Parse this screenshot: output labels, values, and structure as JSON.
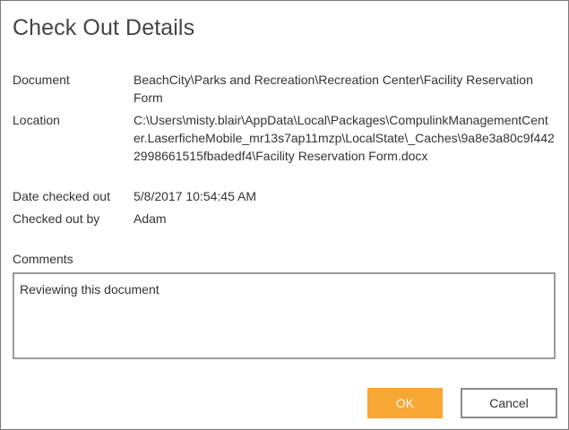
{
  "dialog": {
    "title": "Check Out Details",
    "fields": {
      "document_label": "Document",
      "document_value": "BeachCity\\Parks and Recreation\\Recreation Center\\Facility Reservation Form",
      "location_label": "Location",
      "location_value": "C:\\Users\\misty.blair\\AppData\\Local\\Packages\\CompulinkManagementCenter.LaserficheMobile_mr13s7ap11mzp\\LocalState\\_Caches\\9a8e3a80c9f4422998661515fbadedf4\\Facility Reservation Form.docx",
      "date_label": "Date checked out",
      "date_value": "5/8/2017 10:54:45 AM",
      "by_label": "Checked out by",
      "by_value": "Adam"
    },
    "comments": {
      "label": "Comments",
      "value": "Reviewing this document"
    },
    "buttons": {
      "ok_label": "OK",
      "cancel_label": "Cancel"
    }
  },
  "colors": {
    "ok_button": "#f7a733",
    "title_text": "#444444"
  }
}
